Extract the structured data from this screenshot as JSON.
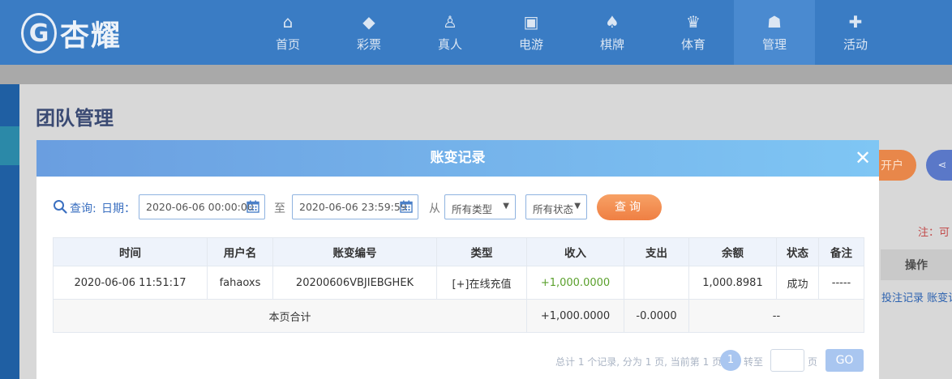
{
  "header": {
    "logo_text": "杏耀",
    "nav": [
      {
        "icon": "home-icon",
        "glyph": "⌂",
        "label": "首页"
      },
      {
        "icon": "ticket-icon",
        "glyph": "◆",
        "label": "彩票"
      },
      {
        "icon": "person-icon",
        "glyph": "♙",
        "label": "真人"
      },
      {
        "icon": "slot-machine-icon",
        "glyph": "▣",
        "label": "电游"
      },
      {
        "icon": "cards-icon",
        "glyph": "♠",
        "label": "棋牌"
      },
      {
        "icon": "trophy-icon",
        "glyph": "♛",
        "label": "体育"
      },
      {
        "icon": "users-icon",
        "glyph": "☗",
        "label": "管理"
      },
      {
        "icon": "gift-icon",
        "glyph": "✚",
        "label": "活动"
      }
    ]
  },
  "page": {
    "title": "团队管理",
    "bg_button_orange": "开户",
    "bg_note": "注：可",
    "bg_table_header": "操作",
    "bg_actions": "投注记录 账变记"
  },
  "modal": {
    "title": "账变记录",
    "close_glyph": "✕",
    "filter": {
      "query_label": "查询:",
      "date_label": "日期：",
      "start_date": "2020-06-06 00:00:00",
      "to_label": "至",
      "end_date": "2020-06-06 23:59:59",
      "from_label": "从",
      "type_select": "所有类型",
      "status_select": "所有状态",
      "query_button": "查询"
    },
    "table": {
      "headers": [
        "时间",
        "用户名",
        "账变编号",
        "类型",
        "收入",
        "支出",
        "余额",
        "状态",
        "备注"
      ],
      "rows": [
        [
          "2020-06-06 11:51:17",
          "fahaoxs",
          "20200606VBJIEBGHEK",
          "[+]在线充值",
          "+1,000.0000",
          "",
          "1,000.8981",
          "成功",
          "-----"
        ]
      ],
      "total": {
        "label": "本页合计",
        "income": "+1,000.0000",
        "expense": "-0.0000",
        "rest": "--"
      }
    },
    "pager": {
      "info": "总计 1 个记录, 分为 1 页, 当前第 1 页",
      "current_page": "1",
      "goto_label": "转至",
      "page_unit": "页",
      "go_button": "GO"
    }
  },
  "colors": {
    "nav_bg": "#3a7cc4",
    "modal_header_start": "#6a9ee0",
    "modal_header_end": "#7fc6f4",
    "query_button": "#ef7f43",
    "income_green": "#5aa02c"
  }
}
